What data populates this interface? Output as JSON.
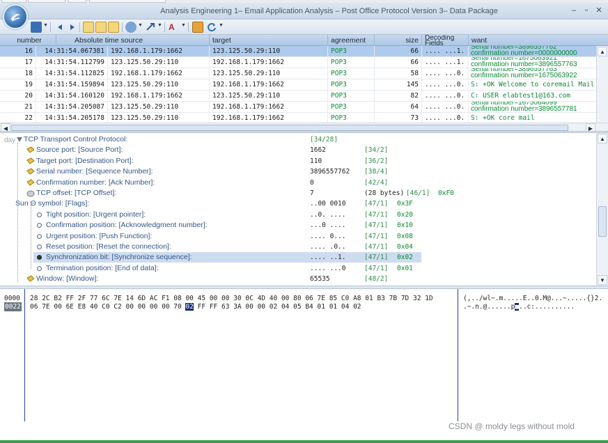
{
  "window": {
    "title": "Analysis Engineering 1– Email Application Analysis – Post Office Protocol Version 3– Data Package",
    "minimize_glyph": "–",
    "restore_glyph": "▫",
    "close_glyph": "✕"
  },
  "toolbar": {
    "icons": [
      "save-icon",
      "back-arrow-icon",
      "forward-arrow-icon",
      "layout-list-icon",
      "layout-tree-icon",
      "layout-hex-icon",
      "filter-icon",
      "capture-icon",
      "font-icon",
      "export-icon",
      "refresh-icon"
    ]
  },
  "packet_list": {
    "columns": [
      "number",
      "Absolute time source",
      "target",
      "agreement",
      "size",
      "Decoding Fields",
      "want"
    ],
    "rows": [
      {
        "number": "16",
        "time": "14:31:54.067381",
        "source": "192.168.1.179:1662",
        "target": "123.125.50.29:110",
        "agreement": "POP3",
        "size": "66",
        "decoding": ".... ...1.",
        "want_line1": "Serial number=3896557762",
        "want_line2": "confirmation number=0000000000",
        "selected": true
      },
      {
        "number": "17",
        "time": "14:31:54.112799",
        "source": "123.125.50.29:110",
        "target": "192.168.1.179:1662",
        "agreement": "POP3",
        "size": "66",
        "decoding": ".... ...1.",
        "want_line1": "Serial number=1675063921",
        "want_line2": "confirmation number=3896557763",
        "selected": false
      },
      {
        "number": "18",
        "time": "14:31:54.112825",
        "source": "192.168.1.179:1662",
        "target": "123.125.50.29:110",
        "agreement": "POP3",
        "size": "58",
        "decoding": ".... ...0.",
        "want_line1": "Serial number=3896557763",
        "want_line2": "confirmation number=1675063922",
        "selected": false
      },
      {
        "number": "19",
        "time": "14:31:54.159894",
        "source": "123.125.50.29:110",
        "target": "192.168.1.179:1662",
        "agreement": "POP3",
        "size": "145",
        "decoding": ".... ...0.",
        "want_line1": "S: +OK Welcome to coremail Mail Pop",
        "want_line2": "",
        "selected": false
      },
      {
        "number": "20",
        "time": "14:31:54.160120",
        "source": "192.168.1.179:1662",
        "target": "123.125.50.29:110",
        "agreement": "POP3",
        "size": "82",
        "decoding": ".... ...0.",
        "want_line1": "C: USER elabtest1@163.com",
        "want_line2": "",
        "selected": false
      },
      {
        "number": "21",
        "time": "14:31:54.205087",
        "source": "123.125.50.29:110",
        "target": "192.168.1.179:1662",
        "agreement": "POP3",
        "size": "64",
        "decoding": ".... ...0.",
        "want_line1": "Serial number=1675064099",
        "want_line2": "confirmation number=3896557781",
        "selected": false
      },
      {
        "number": "22",
        "time": "14:31:54.205178",
        "source": "123.125.50.29:110",
        "target": "192.168.1.179:1662",
        "agreement": "POP3",
        "size": "73",
        "decoding": ".... ...0.",
        "want_line1": "S: +OK core mail",
        "want_line2": "",
        "selected": false
      }
    ]
  },
  "decode_tree": {
    "root_prefix": "day",
    "nodes": [
      {
        "label": "TCP Transport Control Protocol:",
        "value": "",
        "meta": "",
        "offset": "[34/28]",
        "hex": "",
        "icon": "expand",
        "indent": 0,
        "highlight": false
      },
      {
        "label": "Source port: [Source Port]:",
        "value": "1662",
        "meta": "",
        "offset": "[34/2]",
        "hex": "",
        "icon": "field",
        "indent": 1,
        "highlight": false
      },
      {
        "label": "Target port: [Destination Port]:",
        "value": "110",
        "meta": "",
        "offset": "[36/2]",
        "hex": "",
        "icon": "field",
        "indent": 1,
        "highlight": false
      },
      {
        "label": "Serial number: [Sequence Number]:",
        "value": "3896557762",
        "meta": "",
        "offset": "[38/4]",
        "hex": "",
        "icon": "field2",
        "indent": 1,
        "highlight": false
      },
      {
        "label": "Confirmation number: [Ack Number]:",
        "value": "0",
        "meta": "",
        "offset": "[42/4]",
        "hex": "",
        "icon": "field2",
        "indent": 1,
        "highlight": false
      },
      {
        "label": "TCP offset: [TCP Offset]:",
        "value": "7",
        "meta": "(28 bytes)",
        "offset": "[46/1]",
        "hex": "0xF0",
        "icon": "disk",
        "indent": 1,
        "highlight": false
      },
      {
        "label": "Sun Θ symbol: [Flags]:",
        "value": "..00 0010",
        "meta": "",
        "offset": "[47/1]",
        "hex": "0x3F",
        "icon": "none",
        "indent": 1,
        "highlight": false
      },
      {
        "label": "Tight position: [Urgent pointer]:",
        "value": "..0. ....",
        "meta": "",
        "offset": "[47/1]",
        "hex": "0x20",
        "icon": "dot",
        "indent": 2,
        "highlight": false
      },
      {
        "label": "Confirmation position: [Acknowledgment number]:",
        "value": "...0 ....",
        "meta": "",
        "offset": "[47/1]",
        "hex": "0x10",
        "icon": "dot",
        "indent": 2,
        "highlight": false
      },
      {
        "label": "Urgent position: [Push Function]:",
        "value": ".... 0...",
        "meta": "",
        "offset": "[47/1]",
        "hex": "0x08",
        "icon": "dot",
        "indent": 2,
        "highlight": false
      },
      {
        "label": "Reset position: [Reset the connection]:",
        "value": ".... .0..",
        "meta": "",
        "offset": "[47/1]",
        "hex": "0x04",
        "icon": "dot",
        "indent": 2,
        "highlight": false
      },
      {
        "label": "Synchronization bit: [Synchronize sequence]:",
        "value": ".... ..1.",
        "meta": "",
        "offset": "[47/1]",
        "hex": "0x02",
        "icon": "dotfilled",
        "indent": 2,
        "highlight": true
      },
      {
        "label": "Termination position: [End of data]:",
        "value": ".... ...0",
        "meta": "",
        "offset": "[47/1]",
        "hex": "0x01",
        "icon": "dot",
        "indent": 2,
        "highlight": false
      },
      {
        "label": "Window: [Window]:",
        "value": "65535",
        "meta": "",
        "offset": "[48/2]",
        "hex": "",
        "icon": "field",
        "indent": 1,
        "highlight": false
      }
    ]
  },
  "hex_view": {
    "lines": [
      {
        "offset": "0000",
        "bytes": [
          "28",
          "2C",
          "B2",
          "FF",
          "2F",
          "77",
          "6C",
          "7E",
          "14",
          "6D",
          "AC",
          "F1",
          "08",
          "00",
          "45",
          "00",
          "00",
          "30",
          "0C",
          "4D",
          "40",
          "00",
          "80",
          "06",
          "7E",
          "85",
          "C0",
          "A8",
          "01",
          "B3",
          "7B",
          "7D",
          "32",
          "1D"
        ],
        "ascii_before": "(,../wl~.m.....E..0.M@...~.....{}2.",
        "ascii_hl": "",
        "ascii_after": "",
        "current": false
      },
      {
        "offset": "0022",
        "bytes": [
          "06",
          "7E",
          "00",
          "6E",
          "E8",
          "40",
          "C0",
          "C2",
          "00",
          "00",
          "00",
          "00",
          "70",
          "02",
          "FF",
          "FF",
          "63",
          "3A",
          "00",
          "00",
          "02",
          "04",
          "05",
          "B4",
          "01",
          "01",
          "04",
          "02"
        ],
        "highlight_index": 13,
        "ascii_before": ".~.n.@......p",
        "ascii_hl": "■",
        "ascii_after": "..c:..........",
        "current": true
      }
    ]
  },
  "watermark": "CSDN @ moldy legs without mold"
}
